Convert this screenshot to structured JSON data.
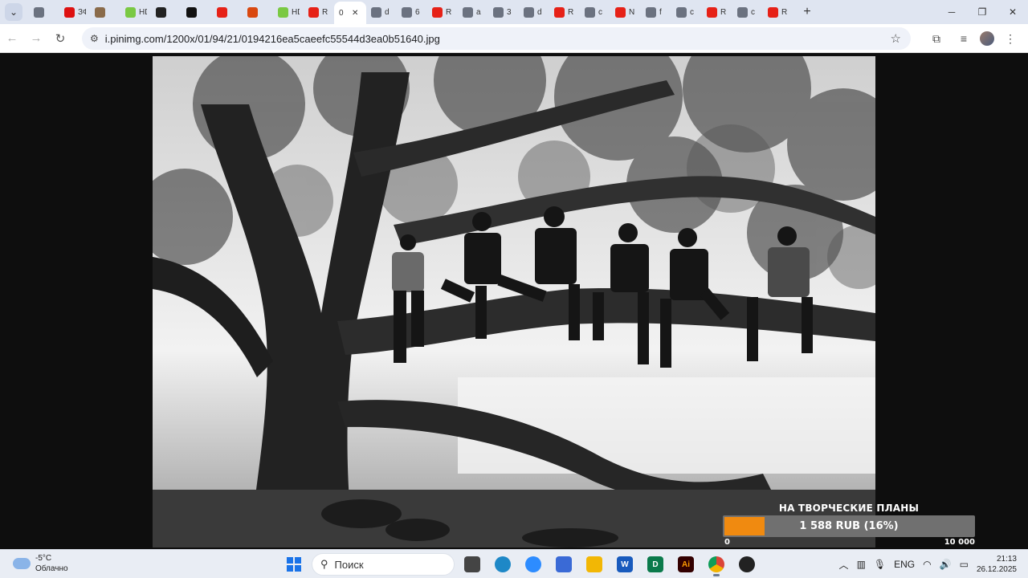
{
  "browser": {
    "tabs": [
      {
        "label": "",
        "favicon": "globe-icon",
        "color": "#6b7280"
      },
      {
        "label": "ЗФ",
        "favicon": "zf-icon",
        "color": "#d11"
      },
      {
        "label": "",
        "favicon": "avatar-icon",
        "color": "#8a6b4a"
      },
      {
        "label": "HD",
        "favicon": "hd-icon",
        "color": "#7ac943"
      },
      {
        "label": "",
        "favicon": "kinopoisk-icon",
        "color": "#222"
      },
      {
        "label": "",
        "favicon": "a-icon",
        "color": "#111"
      },
      {
        "label": "",
        "favicon": "youtube-icon",
        "color": "#e62117"
      },
      {
        "label": "",
        "favicon": "k-icon",
        "color": "#d9480f"
      },
      {
        "label": "HD",
        "favicon": "hd-icon",
        "color": "#7ac943"
      },
      {
        "label": "R",
        "favicon": "youtube-icon",
        "color": "#e62117"
      },
      {
        "label": "0",
        "favicon": "",
        "color": "#fff",
        "active": true
      },
      {
        "label": "d",
        "favicon": "globe-icon",
        "color": "#6b7280"
      },
      {
        "label": "6",
        "favicon": "globe-icon",
        "color": "#6b7280"
      },
      {
        "label": "R",
        "favicon": "youtube-icon",
        "color": "#e62117"
      },
      {
        "label": "a",
        "favicon": "globe-icon",
        "color": "#6b7280"
      },
      {
        "label": "3",
        "favicon": "globe-icon",
        "color": "#6b7280"
      },
      {
        "label": "d",
        "favicon": "globe-icon",
        "color": "#6b7280"
      },
      {
        "label": "R",
        "favicon": "youtube-icon",
        "color": "#e62117"
      },
      {
        "label": "c",
        "favicon": "globe-icon",
        "color": "#6b7280"
      },
      {
        "label": "N",
        "favicon": "youtube-icon",
        "color": "#e62117"
      },
      {
        "label": "f",
        "favicon": "globe-icon",
        "color": "#6b7280"
      },
      {
        "label": "c",
        "favicon": "globe-icon",
        "color": "#6b7280"
      },
      {
        "label": "R",
        "favicon": "youtube-icon",
        "color": "#e62117"
      },
      {
        "label": "c",
        "favicon": "globe-icon",
        "color": "#6b7280"
      },
      {
        "label": "R",
        "favicon": "youtube-icon",
        "color": "#e62117"
      }
    ],
    "url": "i.pinimg.com/1200x/01/94/21/0194216ea5caeefc55544d3ea0b51640.jpg"
  },
  "donation": {
    "title": "НА ТВОРЧЕСКИЕ ПЛАНЫ",
    "amount": "1 588 RUB (16%)",
    "progress": 0.16,
    "min_label": "0",
    "max_label": "10 000",
    "fill_color": "#f08a10"
  },
  "taskbar": {
    "weather_temp": "-5°C",
    "weather_desc": "Облачно",
    "search_placeholder": "Поиск",
    "language": "ENG",
    "time": "21:13",
    "date": "26.12.2025"
  }
}
